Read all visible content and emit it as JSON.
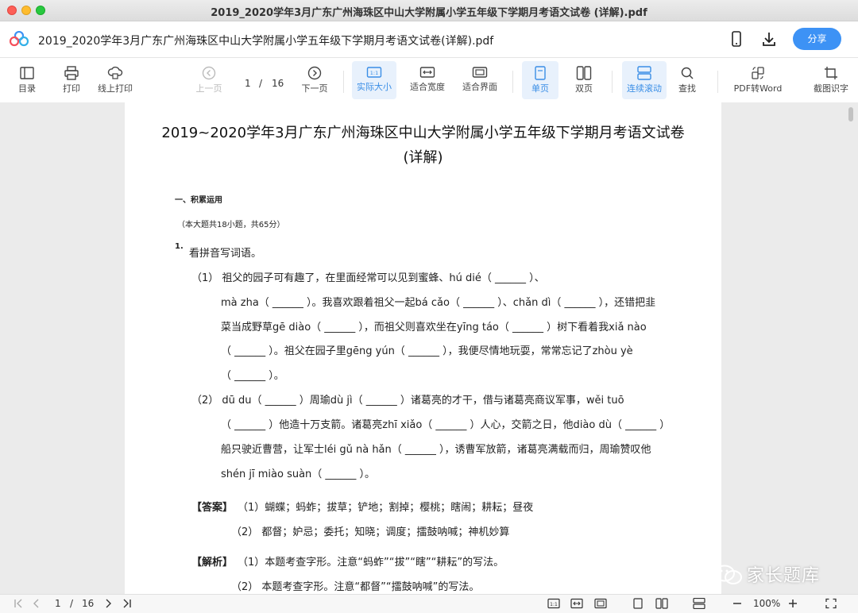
{
  "window": {
    "title": "2019_2020学年3月广东广州海珠区中山大学附属小学五年级下学期月考语文试卷 (详解).pdf"
  },
  "appbar": {
    "filename": "2019_2020学年3月广东广州海珠区中山大学附属小学五年级下学期月考语文试卷(详解).pdf",
    "share_label": "分享"
  },
  "toolbar": {
    "toc": "目录",
    "print": "打印",
    "online_print": "线上打印",
    "prev_page": "上一页",
    "next_page": "下一页",
    "current_page": "1",
    "separator": "/",
    "total_pages": "16",
    "actual_size": "实际大小",
    "fit_width": "适合宽度",
    "fit_page": "适合界面",
    "single_page": "单页",
    "double_page": "双页",
    "continuous_scroll": "连续滚动",
    "find": "查找",
    "pdf_to_word": "PDF转Word",
    "screenshot_ocr": "截图识字"
  },
  "document": {
    "title_line1": "2019~2020学年3月广东广州海珠区中山大学附属小学五年级下学期月考语文试卷",
    "title_line2": "(详解)",
    "section1": "一、积累运用",
    "section1_note": "（本大题共18小题，共65分）",
    "q1_num": "1.",
    "q1_text": "看拼音写词语。",
    "lines": [
      "（1） 祖父的园子可有趣了，在里面经常可以见到蜜蜂、hú dié（ ______ ）、",
      "mà zha（ ______ ）。我喜欢跟着祖父一起bá cǎo（ ______ ）、chǎn dì（ ______ ），还错把韭",
      "菜当成野草gē diào（ ______ ），而祖父则喜欢坐在yīng táo（ ______ ）树下看着我xiǎ nào",
      "（ ______ ）。祖父在园子里gēng yún（ ______ ），我便尽情地玩耍，常常忘记了zhòu yè",
      "（ ______ ）。",
      "（2） dū du（ ______ ）周瑜dù jì（ ______ ）诸葛亮的才干，借与诸葛亮商议军事，wěi tuō",
      "（ ______ ）他造十万支箭。诸葛亮zhī xiǎo（ ______ ）人心，交箭之日，他diào dù（ ______ ）",
      "船只驶近曹营，让军士léi gǔ nà hǎn（ ______ ），诱曹军放箭，诸葛亮满载而归，周瑜赞叹他",
      "shén jī miào suàn（ ______ ）。"
    ],
    "answer_label": "【答案】",
    "answer1": "（1）蝴蝶；蚂蚱；拔草；铲地；割掉；樱桃；瞎闹；耕耘；昼夜",
    "answer2": "（2） 都督；妒忌；委托；知晓；调度；擂鼓呐喊；神机妙算",
    "analysis_label": "【解析】",
    "analysis1": "（1）本题考查字形。注意“蚂蚱”“拔”“瞎”“耕耘”的写法。",
    "analysis2": "（2） 本题考查字形。注意“都督”“擂鼓呐喊”的写法。"
  },
  "statusbar": {
    "current_page": "1",
    "separator": "/",
    "total_pages": "16",
    "zoom": "100%"
  },
  "watermark": {
    "text": "家长题库"
  },
  "colors": {
    "accent": "#3a8ee6",
    "share": "#3d92f5"
  }
}
